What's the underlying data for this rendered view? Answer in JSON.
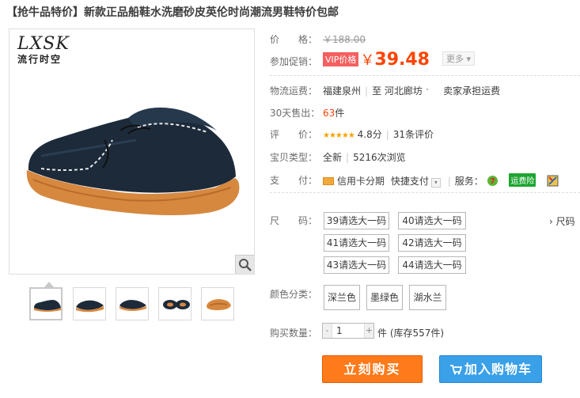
{
  "product": {
    "title": "【抢牛品特价】新款正品船鞋水洗磨砂皮英伦时尚潮流男鞋特价包邮"
  },
  "gallery": {
    "logo_text": "LXSK",
    "logo_subtext": "流行时空",
    "zoom_icon": "magnifier-icon",
    "thumbnail_count": 5,
    "active_thumbnail": 1
  },
  "price": {
    "label": "价　　格：",
    "original": "￥188.00",
    "promo_label": "参加促销：",
    "vip_tag": "VIP价格",
    "currency": "￥",
    "current": "39.48",
    "more_label": "更多"
  },
  "shipping": {
    "label": "物流运费：",
    "from": "福建泉州",
    "to_prefix": "至",
    "to": "河北廊坊",
    "fee": "卖家承担运费"
  },
  "sales": {
    "label": "30天售出：",
    "count": "63",
    "unit": "件"
  },
  "rating": {
    "label": "评　　价：",
    "stars": "★★★★★",
    "score": "4.8分",
    "reviews": "31条评价"
  },
  "listing": {
    "label": "宝贝类型：",
    "type": "全新",
    "views": "5216次浏览"
  },
  "payment": {
    "label": "支　　付：",
    "credit": "信用卡分期",
    "quick": "快捷支付",
    "service_label": "服务：",
    "service_badge": "运费险"
  },
  "size": {
    "label": "尺　　码：",
    "options": [
      "39请选大一码",
      "40请选大一码",
      "41请选大一码",
      "42请选大一码",
      "43请选大一码",
      "44请选大一码"
    ],
    "size_chart_link": "› 尺码"
  },
  "color": {
    "label": "颜色分类：",
    "options": [
      "深兰色",
      "墨绿色",
      "湖水兰"
    ]
  },
  "quantity": {
    "label": "购买数量：",
    "value": "1",
    "minus": "-",
    "plus": "+",
    "unit": "件",
    "stock": "(库存557件)"
  },
  "actions": {
    "buy_now": "立刻购买",
    "add_to_cart": "加入购物车"
  },
  "colors": {
    "price": "#ff4400",
    "buy_button": "#ff7a1a",
    "cart_button": "#3aa0e8",
    "vip_tag": "#f55f5f"
  }
}
